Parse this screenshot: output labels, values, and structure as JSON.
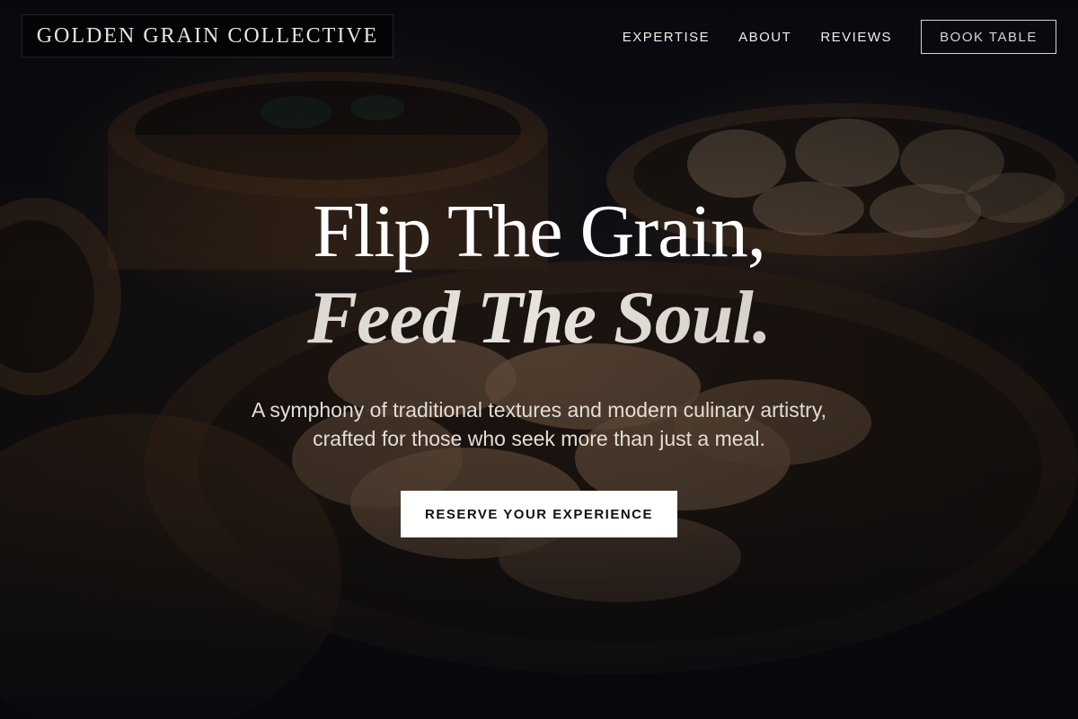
{
  "header": {
    "logo_text": "GOLDEN GRAIN COLLECTIVE",
    "nav": [
      {
        "label": "EXPERTISE"
      },
      {
        "label": "ABOUT"
      },
      {
        "label": "REVIEWS"
      }
    ],
    "book_button": "BOOK TABLE"
  },
  "hero": {
    "headline_line1": "Flip The Grain,",
    "headline_line2": "Feed The Soul.",
    "subtitle": "A symphony of traditional textures and modern culinary artistry, crafted for those who seek more than just a meal.",
    "cta_label": "RESERVE YOUR EXPERIENCE",
    "background_image": "dim-sum-steamer-baskets"
  },
  "colors": {
    "page_bg": "#0b0d12",
    "heading_white": "#ffffff",
    "cta_bg": "#ffffff",
    "cta_text": "#111111"
  }
}
